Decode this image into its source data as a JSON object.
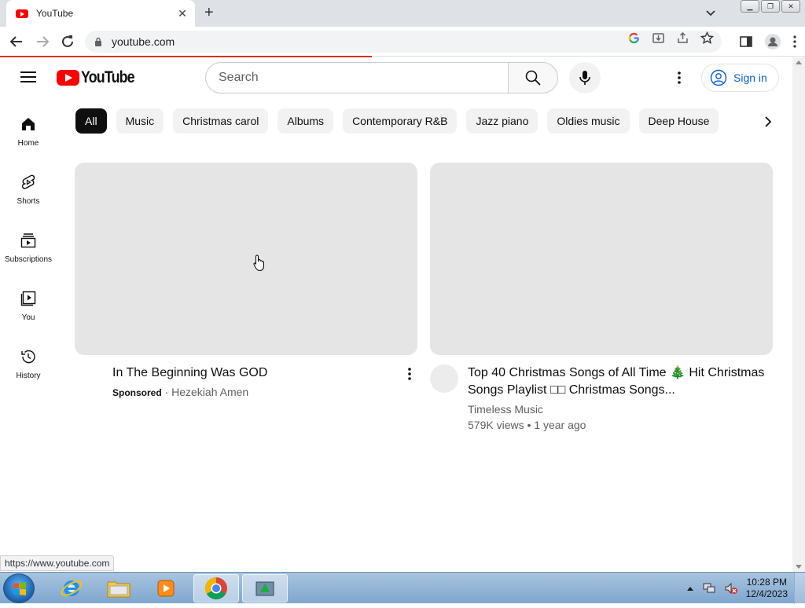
{
  "browser": {
    "tab_title": "YouTube",
    "url": "youtube.com",
    "status_url": "https://www.youtube.com"
  },
  "masthead": {
    "logo_text": "YouTube",
    "search_placeholder": "Search",
    "signin_label": "Sign in"
  },
  "guide": {
    "items": [
      {
        "label": "Home",
        "icon": "home-icon"
      },
      {
        "label": "Shorts",
        "icon": "shorts-icon"
      },
      {
        "label": "Subscriptions",
        "icon": "subscriptions-icon"
      },
      {
        "label": "You",
        "icon": "you-icon"
      },
      {
        "label": "History",
        "icon": "history-icon"
      }
    ]
  },
  "chips": [
    "All",
    "Music",
    "Christmas carol",
    "Albums",
    "Contemporary R&B",
    "Jazz piano",
    "Oldies music",
    "Deep House"
  ],
  "videos": [
    {
      "title": "In The Beginning Was GOD",
      "sponsored_label": "Sponsored",
      "separator": " · ",
      "channel": "Hezekiah Amen"
    },
    {
      "title": "Top 40 Christmas Songs of All Time 🎄 Hit Christmas Songs Playlist □□ Christmas Songs...",
      "channel": "Timeless Music",
      "stats": "579K views • 1 year ago"
    }
  ],
  "taskbar": {
    "time": "10:28 PM",
    "date": "12/4/2023"
  },
  "colors": {
    "youtube_red": "#ff0000",
    "link_blue": "#065fd4",
    "chip_bg": "#f2f2f2",
    "thumb_placeholder": "#e5e5e5",
    "loading_bar": "#d93025"
  }
}
